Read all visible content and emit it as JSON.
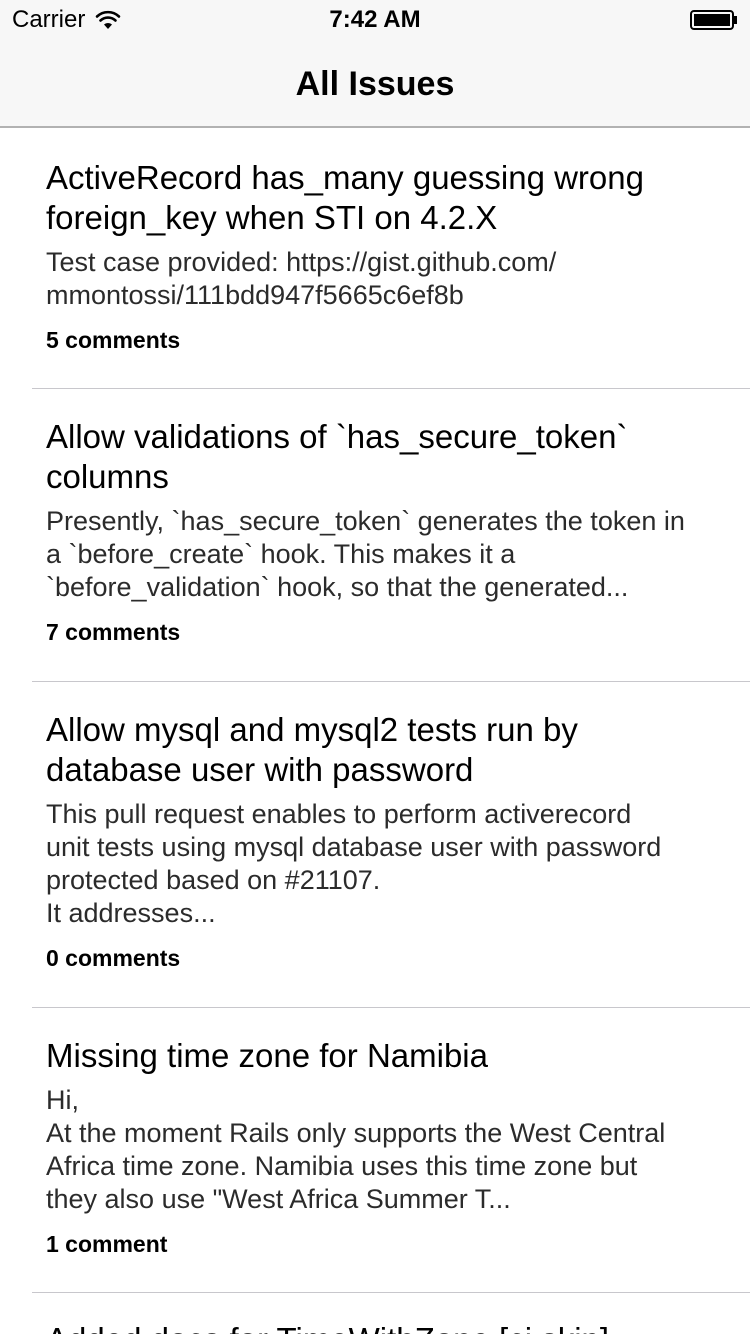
{
  "status_bar": {
    "carrier": "Carrier",
    "time": "7:42 AM"
  },
  "nav": {
    "title": "All Issues"
  },
  "issues": [
    {
      "title": "ActiveRecord has_many guessing wrong\nforeign_key when STI on 4.2.X",
      "body": "Test case provided: https://gist.github.com/\nmmontossi/111bdd947f5665c6ef8b",
      "comments": "5 comments"
    },
    {
      "title": "Allow validations of `has_secure_token`\ncolumns",
      "body": "Presently, `has_secure_token` generates the token in\na `before_create` hook. This makes it a\n`before_validation` hook, so that the generated...",
      "comments": "7 comments"
    },
    {
      "title": "Allow mysql and mysql2 tests run by\ndatabase user with password",
      "body": "This pull request enables to perform activerecord\nunit tests using mysql database user with password\nprotected based on #21107.\nIt addresses...",
      "comments": "0 comments"
    },
    {
      "title": "Missing time zone for Namibia",
      "body": "Hi,\nAt the moment Rails only supports the West Central\nAfrica time zone. Namibia uses this time zone but\nthey also use \"West Africa Summer T...",
      "comments": "1 comment"
    },
    {
      "title": "Added docs for TimeWithZone [ci skip]",
      "body": "",
      "comments": ""
    }
  ],
  "colors": {
    "nav_background": "#f7f7f7",
    "separator": "#c8c7cc"
  },
  "icons": {
    "wifi": "wifi-icon",
    "battery": "battery-icon"
  }
}
